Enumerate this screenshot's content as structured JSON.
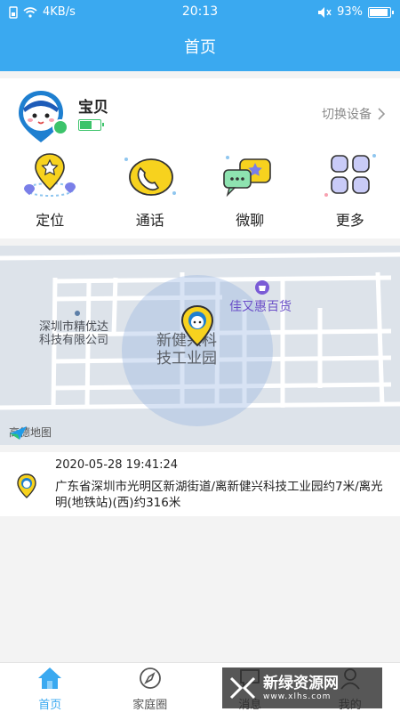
{
  "status": {
    "network_speed": "4KB/s",
    "time": "20:13",
    "battery": "93%",
    "battery_level": 0.93
  },
  "header": {
    "title": "首页"
  },
  "device": {
    "name": "宝贝",
    "switch_label": "切换设备",
    "battery_level": 0.6
  },
  "menu": [
    {
      "label": "定位",
      "icon": "location-icon"
    },
    {
      "label": "通话",
      "icon": "phone-icon"
    },
    {
      "label": "微聊",
      "icon": "chat-icon"
    },
    {
      "label": "更多",
      "icon": "more-icon"
    }
  ],
  "map": {
    "poi_shop": "佳又惠百货",
    "company_line1": "深圳市精优达",
    "company_line2": "科技有限公司",
    "park_line1": "新健兴科",
    "park_line2": "技工业园",
    "provider": "高德地图"
  },
  "location": {
    "time": "2020-05-28 19:41:24",
    "address": "广东省深圳市光明区新湖街道/离新健兴科技工业园约7米/离光明(地铁站)(西)约316米"
  },
  "nav": [
    {
      "label": "首页",
      "icon": "home-icon",
      "active": true
    },
    {
      "label": "家庭圈",
      "icon": "compass-icon",
      "active": false
    },
    {
      "label": "消息",
      "icon": "message-icon",
      "active": false
    },
    {
      "label": "我的",
      "icon": "profile-icon",
      "active": false
    }
  ],
  "watermark": {
    "main": "新绿资源网",
    "sub": "www.xlhs.com"
  },
  "colors": {
    "primary": "#3aa9f0",
    "battery_green": "#3cc36a",
    "pin_yellow": "#f7d21e"
  }
}
